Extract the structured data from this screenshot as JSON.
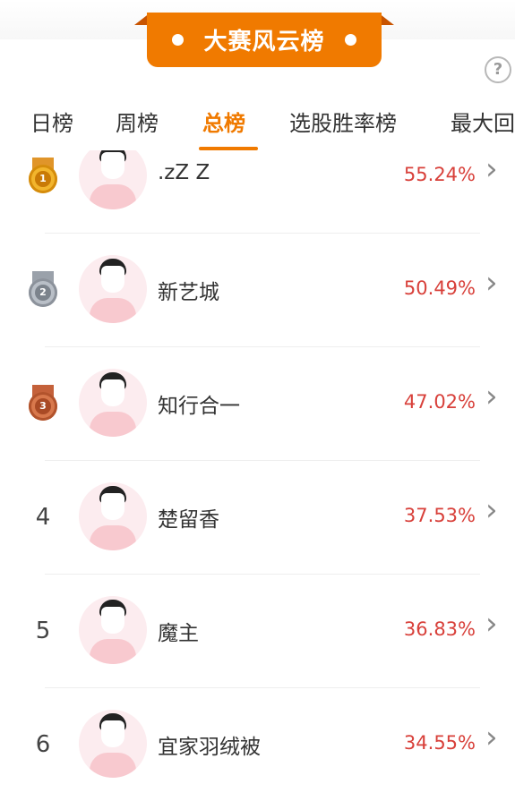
{
  "banner": {
    "title": "大赛风云榜"
  },
  "help": {
    "icon_label": "?"
  },
  "tabs": [
    {
      "label": "日榜",
      "active": false
    },
    {
      "label": "周榜",
      "active": false
    },
    {
      "label": "总榜",
      "active": true
    },
    {
      "label": "选股胜率榜",
      "active": false
    },
    {
      "label": "最大回",
      "active": false
    }
  ],
  "rows": [
    {
      "rank": "1",
      "medal": "gold",
      "name": ".zZ Z",
      "percent": "55.24%"
    },
    {
      "rank": "2",
      "medal": "silver",
      "name": "新艺城",
      "percent": "50.49%"
    },
    {
      "rank": "3",
      "medal": "bronze",
      "name": "知行合一",
      "percent": "47.02%"
    },
    {
      "rank": "4",
      "medal": null,
      "name": "楚留香",
      "percent": "37.53%"
    },
    {
      "rank": "5",
      "medal": null,
      "name": "魔主",
      "percent": "36.83%"
    },
    {
      "rank": "6",
      "medal": null,
      "name": "宜家羽绒被",
      "percent": "34.55%"
    }
  ],
  "colors": {
    "accent": "#f07a00",
    "percent": "#d8403a",
    "gold": "#e3a21a",
    "silver": "#9ea4ad",
    "bronze": "#c9653c"
  }
}
